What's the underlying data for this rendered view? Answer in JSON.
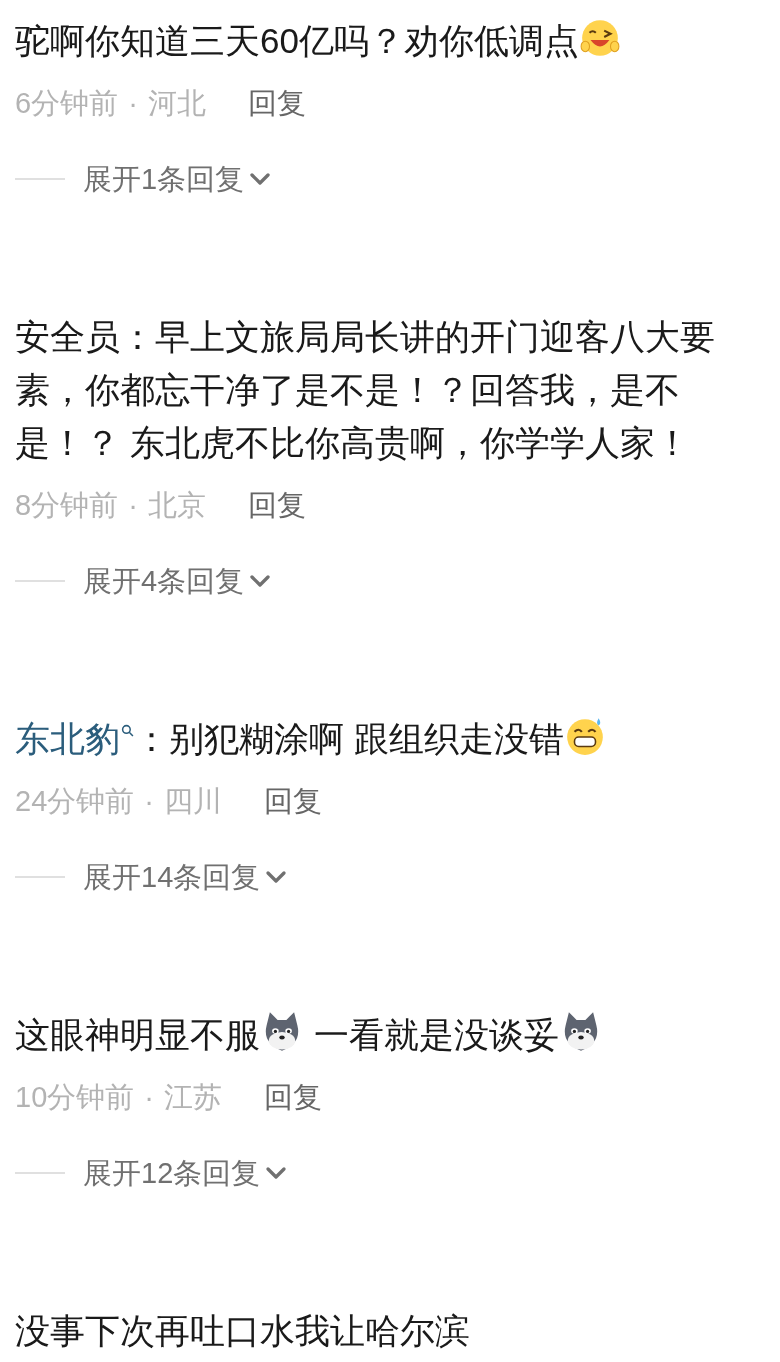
{
  "comments": [
    {
      "body": [
        {
          "kind": "text",
          "text": "驼啊你知道三天60亿吗？劝你低调点"
        },
        {
          "kind": "wink"
        }
      ],
      "time": "6分钟前",
      "separator": "·",
      "region": "河北",
      "reply": "回复",
      "expand": "展开1条回复"
    },
    {
      "body": [
        {
          "kind": "text",
          "text": "安全员：早上文旅局局长讲的开门迎客八大要素，你都忘干净了是不是！？回答我，是不是！？ 东北虎不比你高贵啊，你学学人家！"
        }
      ],
      "time": "8分钟前",
      "separator": "·",
      "region": "北京",
      "reply": "回复",
      "expand": "展开4条回复"
    },
    {
      "body": [
        {
          "kind": "link",
          "text": "东北豹"
        },
        {
          "kind": "text",
          "text": "：别犯糊涂啊 跟组织走没错"
        },
        {
          "kind": "grin"
        }
      ],
      "time": "24分钟前",
      "separator": "·",
      "region": "四川",
      "reply": "回复",
      "expand": "展开14条回复"
    },
    {
      "body": [
        {
          "kind": "text",
          "text": "这眼神明显不服"
        },
        {
          "kind": "husky"
        },
        {
          "kind": "text",
          "text": " 一看就是没谈妥"
        },
        {
          "kind": "husky"
        }
      ],
      "time": "10分钟前",
      "separator": "·",
      "region": "江苏",
      "reply": "回复",
      "expand": "展开12条回复"
    },
    {
      "body": [
        {
          "kind": "text",
          "text": "没事下次再吐口水我让哈尔滨"
        }
      ]
    }
  ]
}
